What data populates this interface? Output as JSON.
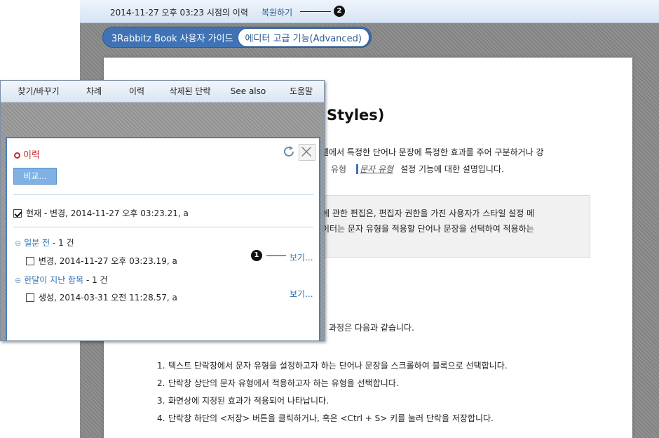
{
  "topbar": {
    "timestamp": "2014-11-27 오후 03:23 시점의 이력",
    "restore_label": "복원하기",
    "callout_number": "2"
  },
  "breadcrumb": {
    "root": "3Rabbitz Book 사용자 가이드",
    "current": "에디터 고급 기능(Advanced)"
  },
  "document": {
    "heading": "Styles)",
    "para1": "셀에서 특정한 단어나 문장에 특정한 효과를 주어 구분하거나 강",
    "para2_prefix": "유형",
    "para2_sample": "문자 유형",
    "para2_suffix": "설정 기능에 대한 설명입니다.",
    "note_line1": "에 관한 편집은, 편집자 권한을 가진 사용자가 스타일 설정 메",
    "note_line2": "이터는 문자 유형을 적용할 단어나 문장을 선택하여 적용하는",
    "procedure_intro": "과정은 다음과 같습니다.",
    "steps": [
      {
        "num": "1.",
        "text": "텍스트 단락창에서 문자 유형을 설정하고자 하는 단어나 문장을 스크롤하여 블록으로 선택합니다."
      },
      {
        "num": "2.",
        "text": "단락창 상단의 문자 유형에서 적용하고자 하는 유형을 선택합니다."
      },
      {
        "num": "3.",
        "text": "화면상에 지정된 효과가 적용되어 나타납니다."
      },
      {
        "num": "4.",
        "text": "단락창 하단의 <저장> 버튼을 클릭하거나, 혹은 <Ctrl + S> 키를 눌러 단락을 저장합니다."
      }
    ]
  },
  "panel": {
    "tabs": [
      "찾기/바꾸기",
      "차례",
      "이력",
      "삭제된 단락",
      "See also",
      "도움말"
    ],
    "history": {
      "title": "이력",
      "compare_label": "비교...",
      "current_entry": "현재 - 변경, 2014-11-27 오후 03:23.21, a",
      "groups": [
        {
          "label": "일분 전",
          "count": " - 1 건",
          "entry": "변경, 2014-11-27 오후 03:23.19, a",
          "view_label": "보기..."
        },
        {
          "label": "한달이 지난 항목",
          "count": " - 1 건",
          "entry": "생성, 2014-03-31 오전 11:28.57, a",
          "view_label": "보기..."
        }
      ],
      "callout_number": "1"
    }
  },
  "colors": {
    "accent_blue": "#3f73b5",
    "link_blue": "#2c6fb2",
    "history_red": "#c62a2a",
    "compare_button": "#7fb1e4"
  },
  "icons": {
    "refresh": "refresh-icon",
    "close": "close-icon",
    "collapse": "collapse-icon",
    "history": "history-ring-icon"
  }
}
